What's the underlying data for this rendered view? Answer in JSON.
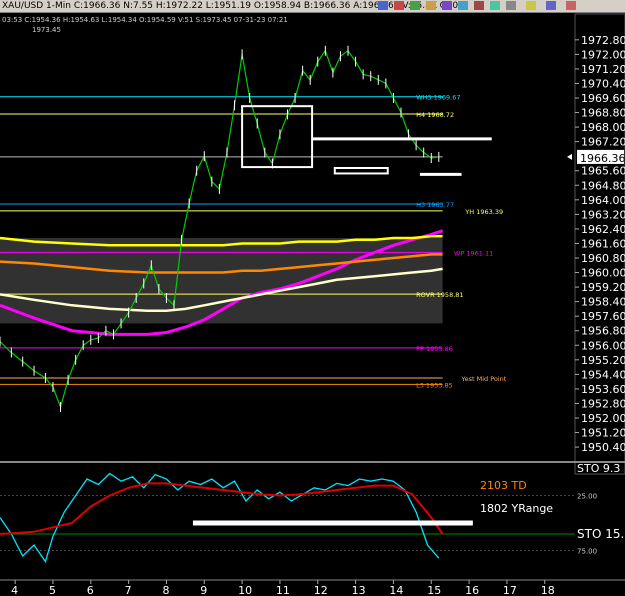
{
  "window": {
    "title": "XAU/USD  1-Min  C:1966.36  N:7.55  H:1972.22  L:1951.19  O:1958.94  B:1966.36  A:1966.67  V:65.8K  OI:0"
  },
  "colors": {
    "background": "#000000",
    "price_line": "#ffffff",
    "candles_up": "#ffffff",
    "candles_down": "#00cc00",
    "scale_bg": "#000000"
  },
  "info_line": "03:53  C:1954.36  H:1954.63  L:1954.34  O:1954.59  V:51  S:1973.45  07-31-23  07:21",
  "crosshair_value": "1973.45",
  "chart_data": [
    {
      "type": "line",
      "panel": "price",
      "ylim": [
        1949.8,
        1973.45
      ],
      "xlim": [
        3.6,
        18.8
      ],
      "x_ticks": [
        "4",
        "5",
        "6",
        "7",
        "8",
        "9",
        "10",
        "11",
        "12",
        "13",
        "14",
        "15",
        "16",
        "17",
        "18"
      ],
      "y_ticks": [
        "1972.80",
        "1972.00",
        "1971.20",
        "1970.40",
        "1969.60",
        "1968.80",
        "1968.00",
        "1967.20",
        "1965.60",
        "1964.80",
        "1964.00",
        "1963.20",
        "1962.40",
        "1961.60",
        "1960.80",
        "1960.00",
        "1959.20",
        "1958.40",
        "1957.60",
        "1956.80",
        "1956.00",
        "1955.20",
        "1954.40",
        "1953.60",
        "1952.80",
        "1952.00",
        "1951.20",
        "1950.40"
      ],
      "last_price": "1966.36",
      "series": [
        {
          "name": "",
          "color": "#00cc00",
          "x": [
            3.6,
            3.9,
            4.2,
            4.5,
            4.8,
            5.0,
            5.2,
            5.4,
            5.6,
            5.8,
            6.0,
            6.2,
            6.4,
            6.6,
            6.8,
            7.0,
            7.2,
            7.4,
            7.6,
            7.8,
            8.0,
            8.2,
            8.4,
            8.6,
            8.8,
            9.0,
            9.2,
            9.4,
            9.6,
            9.8,
            10.0,
            10.2,
            10.4,
            10.6,
            10.8,
            11.0,
            11.2,
            11.4,
            11.6,
            11.8,
            12.0,
            12.2,
            12.4,
            12.6,
            12.8,
            13.0,
            13.2,
            13.4,
            13.6,
            13.8,
            14.0,
            14.2,
            14.4,
            14.6,
            14.8,
            15.0,
            15.2
          ],
          "y": [
            1956.2,
            1955.6,
            1955.1,
            1954.6,
            1954.2,
            1953.7,
            1952.6,
            1954.1,
            1955.2,
            1956.0,
            1956.3,
            1956.4,
            1956.8,
            1956.6,
            1957.2,
            1957.8,
            1958.6,
            1959.4,
            1960.4,
            1959.1,
            1958.6,
            1958.2,
            1961.8,
            1963.8,
            1965.6,
            1966.4,
            1965.0,
            1964.6,
            1966.6,
            1969.2,
            1972.0,
            1969.6,
            1968.2,
            1966.6,
            1966.0,
            1967.6,
            1968.7,
            1969.6,
            1971.1,
            1970.6,
            1971.6,
            1972.2,
            1971.0,
            1971.9,
            1972.2,
            1971.6,
            1970.9,
            1970.8,
            1970.6,
            1970.4,
            1969.6,
            1968.8,
            1967.6,
            1967.0,
            1966.6,
            1966.3,
            1966.36
          ]
        },
        {
          "name": "",
          "color": "#ff00ff",
          "x": [
            3.6,
            4.5,
            5.5,
            6.5,
            7.5,
            8.0,
            8.5,
            9.0,
            9.5,
            10.0,
            10.5,
            11.0,
            11.5,
            12.0,
            12.5,
            13.0,
            13.5,
            14.0,
            14.5,
            15.0,
            15.3
          ],
          "y": [
            1958.2,
            1957.5,
            1956.8,
            1956.6,
            1956.6,
            1956.7,
            1957.0,
            1957.4,
            1958.0,
            1958.6,
            1958.9,
            1959.1,
            1959.4,
            1959.8,
            1960.2,
            1960.7,
            1961.1,
            1961.5,
            1961.8,
            1962.1,
            1962.3
          ]
        },
        {
          "name": "",
          "color": "#ffffcc",
          "x": [
            3.6,
            4.5,
            5.5,
            6.5,
            7.5,
            8.0,
            8.5,
            9.0,
            9.5,
            10.0,
            10.5,
            11.0,
            11.5,
            12.0,
            12.5,
            13.0,
            13.5,
            14.0,
            14.5,
            15.0,
            15.3
          ],
          "y": [
            1958.8,
            1958.5,
            1958.2,
            1958.0,
            1957.9,
            1957.9,
            1958.0,
            1958.2,
            1958.4,
            1958.6,
            1958.8,
            1959.0,
            1959.2,
            1959.4,
            1959.6,
            1959.7,
            1959.8,
            1959.9,
            1960.0,
            1960.1,
            1960.2
          ]
        },
        {
          "name": "",
          "color": "#ff8800",
          "x": [
            3.6,
            4.5,
            5.5,
            6.5,
            7.5,
            8.0,
            8.5,
            9.0,
            9.5,
            10.0,
            10.5,
            11.0,
            11.5,
            12.0,
            12.5,
            13.0,
            13.5,
            14.0,
            14.5,
            15.0,
            15.3
          ],
          "y": [
            1960.6,
            1960.5,
            1960.3,
            1960.1,
            1960.0,
            1960.0,
            1960.0,
            1960.0,
            1960.0,
            1960.1,
            1960.1,
            1960.2,
            1960.3,
            1960.4,
            1960.5,
            1960.6,
            1960.7,
            1960.8,
            1960.9,
            1961.0,
            1961.0
          ]
        },
        {
          "name": "",
          "color": "#ffff00",
          "x": [
            3.6,
            4.5,
            5.5,
            6.5,
            7.5,
            8.0,
            8.5,
            9.0,
            9.5,
            10.0,
            10.5,
            11.0,
            11.5,
            12.0,
            12.5,
            13.0,
            13.5,
            14.0,
            14.5,
            15.0,
            15.3
          ],
          "y": [
            1961.9,
            1961.7,
            1961.6,
            1961.5,
            1961.5,
            1961.5,
            1961.5,
            1961.5,
            1961.5,
            1961.6,
            1961.6,
            1961.6,
            1961.7,
            1961.7,
            1961.7,
            1961.8,
            1961.8,
            1961.9,
            1961.9,
            1962.0,
            1962.0
          ]
        }
      ],
      "levels": [
        {
          "value": 1969.67,
          "color": "#00e5ff",
          "label": "WH3 1969.67"
        },
        {
          "value": 1968.72,
          "color": "#ffff66",
          "label": "H4 1968.72"
        },
        {
          "value": 1966.36,
          "color": "#bbbbbb",
          "label": ""
        },
        {
          "value": 1963.77,
          "color": "#00a0ff",
          "label": "H3 1963.77"
        },
        {
          "value": 1963.39,
          "color": "#ffff66",
          "label": "YH 1963.39"
        },
        {
          "value": 1961.11,
          "color": "#ff00ff",
          "label": "WP 1961.11"
        },
        {
          "value": 1958.81,
          "color": "#ffff66",
          "label": "ROVR 1958.81"
        },
        {
          "value": 1955.86,
          "color": "#ff00ff",
          "label": "PP 1955.86"
        },
        {
          "value": 1954.2,
          "color": "#ffaa66",
          "label": "Yest Mid Point"
        },
        {
          "value": 1953.85,
          "color": "#ff8800",
          "label": "L3 1953.85"
        }
      ]
    },
    {
      "type": "line",
      "panel": "oscillator",
      "ylim": [
        0,
        100
      ],
      "y_ticks": [
        "25.00",
        "75.00"
      ],
      "inverted": true,
      "series": [
        {
          "name": "",
          "color": "#00e5ff",
          "x": [
            3.6,
            3.9,
            4.2,
            4.5,
            4.8,
            5.0,
            5.3,
            5.6,
            5.9,
            6.2,
            6.5,
            6.8,
            7.1,
            7.4,
            7.7,
            8.0,
            8.3,
            8.6,
            8.9,
            9.2,
            9.5,
            9.8,
            10.1,
            10.4,
            10.7,
            11.0,
            11.3,
            11.6,
            11.9,
            12.2,
            12.5,
            12.8,
            13.1,
            13.4,
            13.7,
            14.0,
            14.3,
            14.6,
            14.9,
            15.2
          ],
          "y": [
            45,
            60,
            80,
            70,
            85,
            62,
            40,
            25,
            10,
            15,
            5,
            12,
            8,
            18,
            6,
            10,
            20,
            12,
            15,
            10,
            18,
            12,
            30,
            20,
            28,
            22,
            30,
            24,
            18,
            20,
            14,
            16,
            10,
            12,
            10,
            12,
            20,
            40,
            70,
            82
          ]
        },
        {
          "name": "",
          "color": "#dd0000",
          "x": [
            3.6,
            4.5,
            5.5,
            6.0,
            6.5,
            7.0,
            7.5,
            8.0,
            8.5,
            9.0,
            9.5,
            10.0,
            10.5,
            11.0,
            11.5,
            12.0,
            12.5,
            13.0,
            13.5,
            14.0,
            14.5,
            15.0,
            15.3
          ],
          "y": [
            60,
            58,
            50,
            35,
            25,
            18,
            14,
            14,
            16,
            18,
            20,
            22,
            24,
            25,
            24,
            22,
            20,
            18,
            16,
            16,
            24,
            45,
            60
          ]
        }
      ],
      "level_line": {
        "value": 60,
        "color": "#008800",
        "label": "STO  15."
      },
      "top_label": "STO  9.3",
      "annotations": [
        "2103 TD",
        "1802 YRange"
      ]
    }
  ]
}
